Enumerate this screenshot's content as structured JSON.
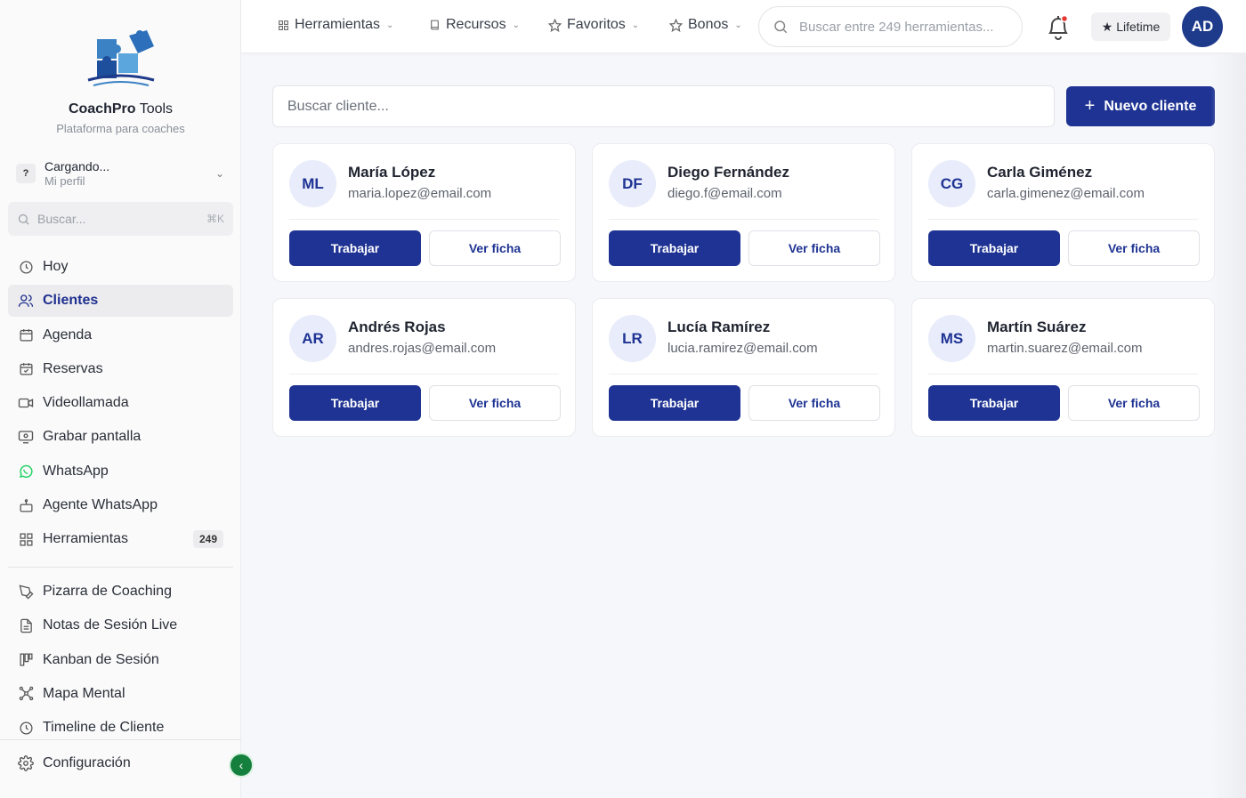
{
  "sidebar": {
    "brand_name": "CoachPro",
    "brand_suffix": " Tools",
    "tagline": "Plataforma para coaches",
    "profile": {
      "initial": "?",
      "name": "Cargando...",
      "sub": "Mi perfil"
    },
    "search": {
      "placeholder": "Buscar...",
      "shortcut": "⌘K"
    },
    "items": [
      {
        "label": "Hoy",
        "icon": "clock-icon"
      },
      {
        "label": "Clientes",
        "icon": "users-icon"
      },
      {
        "label": "Agenda",
        "icon": "calendar-icon"
      },
      {
        "label": "Reservas",
        "icon": "calendar-check-icon"
      },
      {
        "label": "Videollamada",
        "icon": "video-icon"
      },
      {
        "label": "Grabar pantalla",
        "icon": "screen-record-icon"
      },
      {
        "label": "WhatsApp",
        "icon": "whatsapp-icon"
      },
      {
        "label": "Agente WhatsApp",
        "icon": "bot-icon"
      },
      {
        "label": "Herramientas",
        "icon": "grid-icon",
        "badge": "249"
      }
    ],
    "items2": [
      {
        "label": "Pizarra de Coaching",
        "icon": "pen-tool-icon"
      },
      {
        "label": "Notas de Sesión Live",
        "icon": "file-text-icon"
      },
      {
        "label": "Kanban de Sesión",
        "icon": "kanban-icon"
      },
      {
        "label": "Mapa Mental",
        "icon": "network-icon"
      },
      {
        "label": "Timeline de Cliente",
        "icon": "history-icon"
      }
    ],
    "config_label": "Configuración"
  },
  "topbar": {
    "menus": [
      {
        "label": "Herramientas"
      },
      {
        "label": "Recursos"
      },
      {
        "label": "Favoritos"
      },
      {
        "label": "Bonos"
      }
    ],
    "search_placeholder": "Buscar entre 249 herramientas...",
    "lifetime_label": "★ Lifetime",
    "avatar_initials": "AD"
  },
  "main": {
    "client_search_placeholder": "Buscar cliente...",
    "new_client_label": "Nuevo cliente",
    "work_label": "Trabajar",
    "view_label": "Ver ficha",
    "clients": [
      {
        "initials": "ML",
        "name": "María López",
        "email": "maria.lopez@email.com"
      },
      {
        "initials": "DF",
        "name": "Diego Fernández",
        "email": "diego.f@email.com"
      },
      {
        "initials": "CG",
        "name": "Carla Giménez",
        "email": "carla.gimenez@email.com"
      },
      {
        "initials": "AR",
        "name": "Andrés Rojas",
        "email": "andres.rojas@email.com"
      },
      {
        "initials": "LR",
        "name": "Lucía Ramírez",
        "email": "lucia.ramirez@email.com"
      },
      {
        "initials": "MS",
        "name": "Martín Suárez",
        "email": "martin.suarez@email.com"
      }
    ]
  },
  "colors": {
    "primary": "#1e3393",
    "whatsapp": "#25d366",
    "collapse": "#15803d"
  }
}
